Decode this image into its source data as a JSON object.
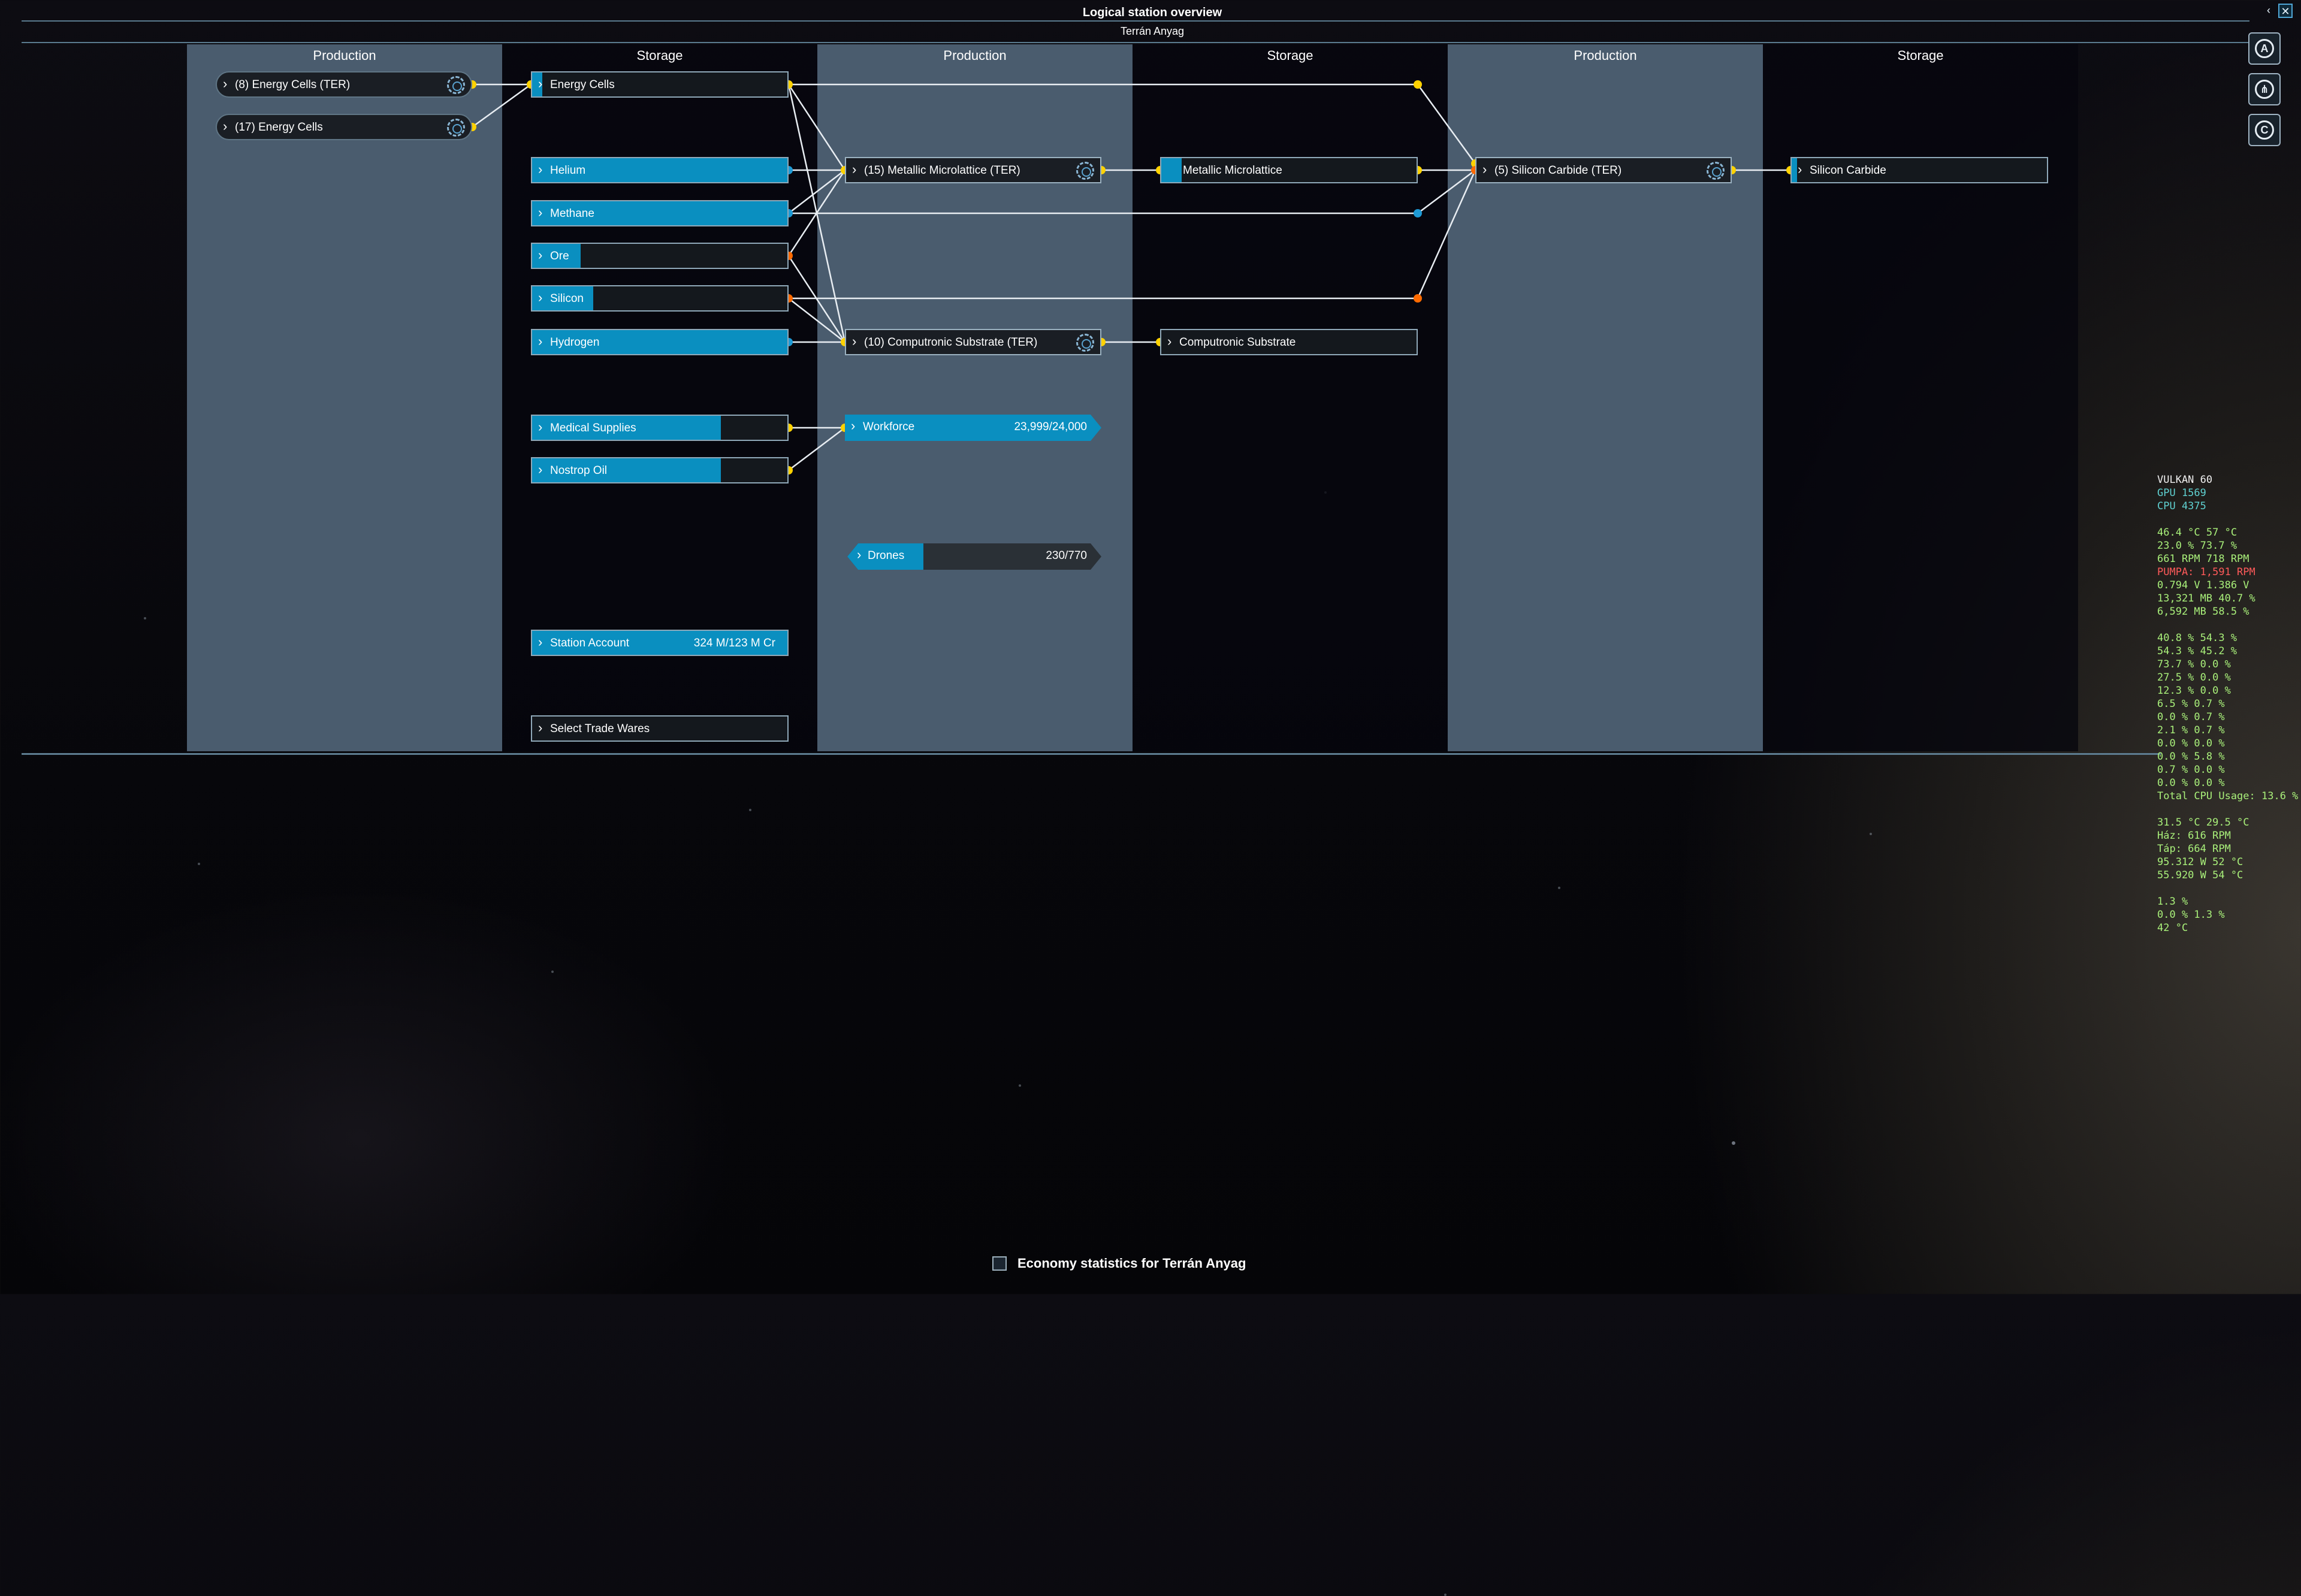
{
  "window": {
    "title": "Logical station overview",
    "subtitle": "Terrán Anyag",
    "back_glyph": "‹",
    "close_glyph": "✕"
  },
  "side_buttons": [
    {
      "name": "autopilot-mode-icon",
      "glyph": "A"
    },
    {
      "name": "share-route-icon",
      "glyph": "⋔"
    },
    {
      "name": "credits-mode-icon",
      "glyph": "C"
    }
  ],
  "columns": [
    {
      "label": "Production"
    },
    {
      "label": "Storage"
    },
    {
      "label": "Production"
    },
    {
      "label": "Storage"
    },
    {
      "label": "Production"
    },
    {
      "label": "Storage"
    }
  ],
  "production_col1": [
    {
      "label": "(8) Energy Cells (TER)"
    },
    {
      "label": "(17) Energy Cells"
    }
  ],
  "storage_col2": [
    {
      "label": "Energy Cells",
      "fill": 0.04
    },
    {
      "label": "Helium",
      "fill": 1.0
    },
    {
      "label": "Methane",
      "fill": 1.0
    },
    {
      "label": "Ore",
      "fill": 0.19
    },
    {
      "label": "Silicon",
      "fill": 0.24
    },
    {
      "label": "Hydrogen",
      "fill": 1.0
    },
    {
      "label": "Medical Supplies",
      "fill": 0.74
    },
    {
      "label": "Nostrop Oil",
      "fill": 0.74
    }
  ],
  "station_account": {
    "label": "Station Account",
    "value": "324 M/123 M Cr"
  },
  "select_trade_wares": {
    "label": "Select Trade Wares"
  },
  "production_col3": [
    {
      "label": "(15) Metallic Microlattice (TER)"
    },
    {
      "label": "(10) Computronic Substrate (TER)"
    }
  ],
  "workforce": {
    "label": "Workforce",
    "value": "23,999/24,000",
    "fill": 1.0
  },
  "drones": {
    "label": "Drones",
    "value": "230/770",
    "fill": 0.3
  },
  "storage_col4": [
    {
      "label": "Metallic Microlattice",
      "fill": 0.08
    },
    {
      "label": "Computronic Substrate",
      "fill": 0.0
    }
  ],
  "production_col5": [
    {
      "label": "(5) Silicon Carbide (TER)"
    }
  ],
  "storage_col6": [
    {
      "label": "Silicon Carbide",
      "fill": 0.02
    }
  ],
  "hud": [
    {
      "text": "VULKAN  60",
      "color": "#f0f0f0"
    },
    {
      "text": "GPU    1569",
      "color": "#5fd0d0"
    },
    {
      "text": "CPU    4375",
      "color": "#5fd0d0"
    },
    {
      "text": "",
      "color": "#a9f07a"
    },
    {
      "text": "46.4 °C 57 °C",
      "color": "#a9f07a"
    },
    {
      "text": "23.0 % 73.7 %",
      "color": "#a9f07a"
    },
    {
      "text": "661 RPM 718 RPM",
      "color": "#a9f07a"
    },
    {
      "text": "PUMPA: 1,591 RPM",
      "color": "#ff5a5a"
    },
    {
      "text": "0.794 V 1.386 V",
      "color": "#a9f07a"
    },
    {
      "text": "13,321 MB 40.7 %",
      "color": "#a9f07a"
    },
    {
      "text": "6,592 MB 58.5 %",
      "color": "#a9f07a"
    },
    {
      "text": "",
      "color": "#a9f07a"
    },
    {
      "text": "40.8 % 54.3 %",
      "color": "#a9f07a"
    },
    {
      "text": "54.3 % 45.2 %",
      "color": "#a9f07a"
    },
    {
      "text": "73.7 % 0.0 %",
      "color": "#a9f07a"
    },
    {
      "text": "27.5 % 0.0 %",
      "color": "#a9f07a"
    },
    {
      "text": "12.3 % 0.0 %",
      "color": "#a9f07a"
    },
    {
      "text": "6.5 % 0.7 %",
      "color": "#a9f07a"
    },
    {
      "text": "0.0 % 0.7 %",
      "color": "#a9f07a"
    },
    {
      "text": "2.1 % 0.7 %",
      "color": "#a9f07a"
    },
    {
      "text": "0.0 % 0.0 %",
      "color": "#a9f07a"
    },
    {
      "text": "0.0 % 5.8 %",
      "color": "#a9f07a"
    },
    {
      "text": "0.7 % 0.0 %",
      "color": "#a9f07a"
    },
    {
      "text": "0.0 % 0.0 %",
      "color": "#a9f07a"
    },
    {
      "text": "Total CPU Usage: 13.6 %",
      "color": "#a9f07a"
    },
    {
      "text": "",
      "color": "#a9f07a"
    },
    {
      "text": "31.5 °C 29.5 °C",
      "color": "#a9f07a"
    },
    {
      "text": "Ház: 616 RPM",
      "color": "#a9f07a"
    },
    {
      "text": "Táp: 664 RPM",
      "color": "#a9f07a"
    },
    {
      "text": "95.312 W 52 °C",
      "color": "#a9f07a"
    },
    {
      "text": "55.920 W 54 °C",
      "color": "#a9f07a"
    },
    {
      "text": "",
      "color": "#a9f07a"
    },
    {
      "text": "1.3 %",
      "color": "#a9f07a"
    },
    {
      "text": "0.0 % 1.3 %",
      "color": "#a9f07a"
    },
    {
      "text": "42 °C",
      "color": "#a9f07a"
    }
  ],
  "footer": {
    "label": "Economy statistics for Terrán Anyag"
  },
  "colors": {
    "accent": "#0a8fc0",
    "link": "#e8edf2",
    "port_yellow": "#ffd200",
    "port_orange": "#ff6a00",
    "port_blue": "#1e9ad6"
  }
}
